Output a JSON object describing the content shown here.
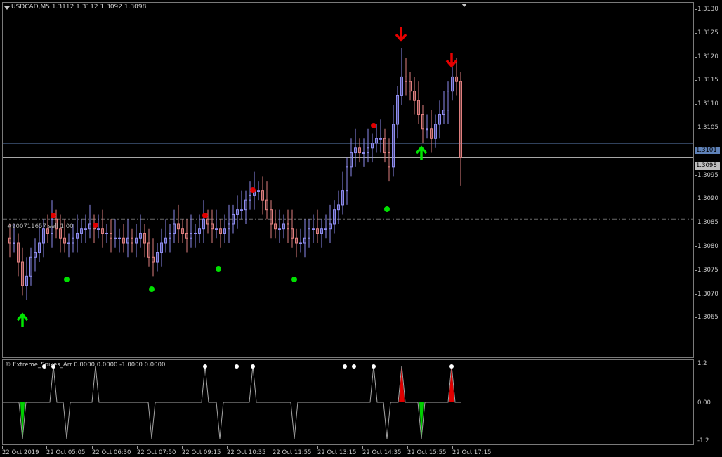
{
  "chart": {
    "symbol_header": "USDCAD,M5  1.3112 1.3112 1.3092 1.3098",
    "order_label": "#900711657 sell 1.00",
    "price_ticks": [
      "1.3130",
      "1.3125",
      "1.3120",
      "1.3115",
      "1.3110",
      "1.3105",
      "1.3100",
      "1.3095",
      "1.3090",
      "1.3085",
      "1.3080",
      "1.3075",
      "1.3070",
      "1.3065"
    ],
    "current_price_label": "1.3098",
    "highlight_price_label": "1.3101",
    "time_labels": [
      "22 Oct 2019",
      "22 Oct 05:05",
      "22 Oct 06:30",
      "22 Oct 07:50",
      "22 Oct 09:15",
      "22 Oct 10:35",
      "22 Oct 11:55",
      "22 Oct 13:15",
      "22 Oct 14:35",
      "22 Oct 15:55",
      "22 Oct 17:15"
    ],
    "colors": {
      "bull": "#8e8cf0",
      "bear": "#e07f7f",
      "buy_arrow": "#00e600",
      "sell_arrow": "#e60000",
      "buy_dot": "#00e000",
      "sell_dot": "#e00000",
      "current_line": "#bfbfbf",
      "highlight_line": "#5f82b8"
    }
  },
  "indicator": {
    "header": "© Extreme_Spikes_Arr 0.0000 0.0000 -1.0000 0.0000",
    "scale_ticks": [
      "1.2",
      "0.00",
      "-1.2"
    ]
  },
  "chart_data": {
    "type": "candlestick",
    "title": "USDCAD,M5",
    "ylim": [
      1.3062,
      1.3132
    ],
    "current_price": 1.3098,
    "horizontal_line": 1.3101,
    "order_line": 1.3085,
    "sell_arrow_prices": [
      1.3124,
      1.3118
    ],
    "buy_arrow_prices": [
      1.3067,
      1.3102
    ],
    "sell_dots": [
      1.3089,
      1.3087,
      1.3089,
      1.3093,
      1.3106
    ],
    "buy_dots": [
      1.3076,
      1.3074,
      1.3078,
      1.3076,
      1.3089
    ],
    "indicator_ylim": [
      -1.2,
      1.2
    ]
  }
}
